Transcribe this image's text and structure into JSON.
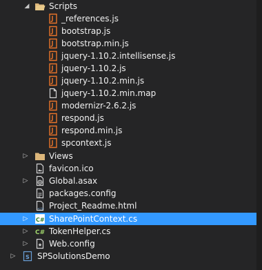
{
  "solution_explorer": {
    "folder_scripts": "Scripts",
    "scripts": [
      {
        "label": "_references.js",
        "icon": "js-file-icon"
      },
      {
        "label": "bootstrap.js",
        "icon": "js-file-icon"
      },
      {
        "label": "bootstrap.min.js",
        "icon": "js-file-icon"
      },
      {
        "label": "jquery-1.10.2.intellisense.js",
        "icon": "js-file-icon"
      },
      {
        "label": "jquery-1.10.2.js",
        "icon": "js-file-icon"
      },
      {
        "label": "jquery-1.10.2.min.js",
        "icon": "js-file-icon"
      },
      {
        "label": "jquery-1.10.2.min.map",
        "icon": "generic-file-icon"
      },
      {
        "label": "modernizr-2.6.2.js",
        "icon": "js-file-icon"
      },
      {
        "label": "respond.js",
        "icon": "js-file-icon"
      },
      {
        "label": "respond.min.js",
        "icon": "js-file-icon"
      },
      {
        "label": "spcontext.js",
        "icon": "js-file-icon"
      }
    ],
    "folder_views": "Views",
    "favicon": "favicon.ico",
    "global_asax": "Global.asax",
    "packages_config": "packages.config",
    "readme": "Project_Readme.html",
    "sharepoint_context": "SharePointContext.cs",
    "token_helper": "TokenHelper.cs",
    "web_config": "Web.config",
    "project": "SPSolutionsDemo"
  },
  "colors": {
    "background": "#252526",
    "selection": "#3399ff",
    "js_icon": "#e8742a",
    "folder": "#dcb67a",
    "csharp": "#9fd46b"
  }
}
